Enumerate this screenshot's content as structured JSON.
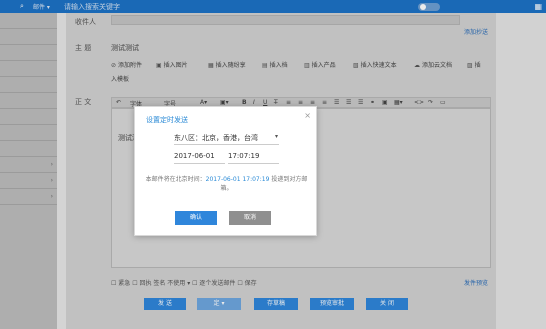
{
  "topbar": {
    "mail_dropdown": "邮件 ▾",
    "search_placeholder": "请输入搜索关键字"
  },
  "compose": {
    "to_label": "收件人",
    "to_suffix_link": "添加抄送",
    "subject_label": "主 题",
    "subject_value": "测试测试",
    "body_label": "正 文",
    "body_text": "测试测",
    "toolbar": [
      {
        "icon": "paperclip-icon",
        "glyph": "⊘",
        "label": "添加附件"
      },
      {
        "icon": "image-icon",
        "glyph": "▣",
        "label": "插入图片"
      },
      {
        "icon": "screenshot-icon",
        "glyph": "▦",
        "label": "插入随纷享"
      },
      {
        "icon": "person-icon",
        "glyph": "▤",
        "label": "插入档"
      },
      {
        "icon": "cart-icon",
        "glyph": "▥",
        "label": "插入产品"
      },
      {
        "icon": "template-icon",
        "glyph": "▧",
        "label": "插入快速文本"
      },
      {
        "icon": "cloud-icon",
        "glyph": "☁",
        "label": "添加云文档"
      },
      {
        "icon": "insert-icon",
        "glyph": "▨",
        "label": "插"
      },
      {
        "icon": "template-icon",
        "glyph": "",
        "label": "入模板"
      }
    ],
    "editor_font": "字体",
    "editor_size": "字号",
    "bottom_options": "☐ 紧急  ☐ 回执  签名 不使用 ▾   ☐ 逐个发送邮件  ☐ 保存",
    "right_link": "发件预览",
    "buttons": {
      "send": "发 送",
      "schedule": "定 ▾",
      "save_draft": "存草稿",
      "preview": "预览审批",
      "close": "关 闭"
    }
  },
  "dialog": {
    "title": "设置定时发送",
    "timezone": "东八区：北京，香港，台湾",
    "date": "2017-06-01",
    "time": "17:07:19",
    "info_prefix": "本邮件将在北京时间：",
    "info_highlight": "2017-06-01 17:07:19",
    "info_suffix": " 投递到对方邮箱。",
    "ok": "确认",
    "cancel": "取消"
  },
  "colors": {
    "topbar": "#1d72c6",
    "accent": "#2f86db",
    "cancel": "#8f8f8f"
  }
}
